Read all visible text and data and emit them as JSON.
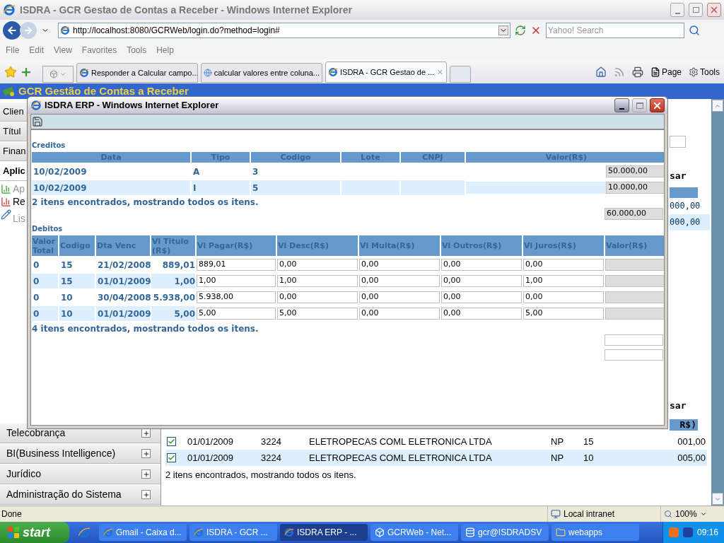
{
  "browser": {
    "title": "ISDRA - GCR Gestao de Contas a Receber - Windows Internet Explorer",
    "address": "http://localhost:8080/GCRWeb/login.do?method=login#",
    "search_placeholder": "Yahoo! Search",
    "menu": [
      "File",
      "Edit",
      "View",
      "Favorites",
      "Tools",
      "Help"
    ],
    "tabs": [
      {
        "label": "Responder a Calcular campo...",
        "selected": false
      },
      {
        "label": "calcular valores entre coluna...",
        "selected": false
      },
      {
        "label": "ISDRA - GCR Gestao de ...",
        "selected": true
      }
    ],
    "command_bar": [
      "Page",
      "Tools"
    ]
  },
  "app": {
    "header": "GCR Gestão de Contas a Receber",
    "sidebar": [
      {
        "kind": "section",
        "label": "Clien",
        "selected": false
      },
      {
        "kind": "section",
        "label": "Títul",
        "selected": false
      },
      {
        "kind": "section",
        "label": "Finan",
        "selected": false
      },
      {
        "kind": "section",
        "label": "Aplic",
        "selected": true
      },
      {
        "kind": "link",
        "label": "Ap"
      },
      {
        "kind": "link",
        "label": "Re"
      },
      {
        "kind": "link",
        "label": "Lis"
      }
    ],
    "sidebar_bottom": [
      {
        "label": "Telecobrança",
        "expanded": false
      },
      {
        "label": "BI(Business Intelligence)",
        "expanded": false
      },
      {
        "label": "Jurídico",
        "expanded": false
      },
      {
        "label": "Administração do Sistema",
        "expanded": false
      }
    ],
    "right_panel": {
      "label_1": "sar",
      "values": [
        "000,00",
        "000,00"
      ],
      "label_2": "sar",
      "header": "R$)"
    },
    "rows": [
      {
        "checked": true,
        "date": "01/01/2009",
        "code": "3224",
        "company": "ELETROPECAS COML ELETRONICA LTDA",
        "type": "NP",
        "number": "15",
        "value": "001,00"
      },
      {
        "checked": true,
        "date": "01/01/2009",
        "code": "3224",
        "company": "ELETROPECAS COML ELETRONICA LTDA",
        "type": "NP",
        "number": "10",
        "value": "005,00"
      }
    ],
    "footer": "2 itens encontrados, mostrando todos os itens."
  },
  "popup": {
    "title": "ISDRA ERP - Windows Internet Explorer",
    "creditos": {
      "label": "Creditos",
      "columns": [
        "Data",
        "Tipo",
        "Codigo",
        "Lote",
        "CNPJ",
        "Valor(R$)"
      ],
      "rows": [
        {
          "data": "10/02/2009",
          "tipo": "A",
          "codigo": "3",
          "valor": "50.000,00"
        },
        {
          "data": "10/02/2009",
          "tipo": "I",
          "codigo": "5",
          "valor": "10.000,00"
        }
      ],
      "footer": "2 itens encontrados, mostrando todos os itens.",
      "total": "60.000,00"
    },
    "debitos": {
      "label": "Debitos",
      "columns": [
        "Valor Total",
        "Codigo",
        "Dta Venc",
        "Vl Titulo (R$)",
        "Vl Pagar(R$)",
        "Vl Desc(R$)",
        "Vl Multa(R$)",
        "Vl Outros(R$)",
        "Vl Juros(R$)",
        "Valor(R$)"
      ],
      "rows": [
        {
          "valor_total": "0",
          "codigo": "15",
          "dta_venc": "21/02/2008",
          "vl_titulo": "889,01",
          "inputs": [
            "889,01",
            "0,00",
            "0,00",
            "0,00",
            "0,00"
          ]
        },
        {
          "valor_total": "0",
          "codigo": "15",
          "dta_venc": "01/01/2009",
          "vl_titulo": "1,00",
          "inputs": [
            "1,00",
            "1,00",
            "0,00",
            "0,00",
            "1,00"
          ]
        },
        {
          "valor_total": "0",
          "codigo": "10",
          "dta_venc": "30/04/2008",
          "vl_titulo": "5.938,00",
          "inputs": [
            "5.938,00",
            "0,00",
            "0,00",
            "0,00",
            "0,00"
          ]
        },
        {
          "valor_total": "0",
          "codigo": "10",
          "dta_venc": "01/01/2009",
          "vl_titulo": "5,00",
          "inputs": [
            "5,00",
            "5,00",
            "0,00",
            "0,00",
            "5,00"
          ]
        }
      ],
      "footer": "4 itens encontrados, mostrando todos os itens."
    }
  },
  "status_bar": {
    "text": "Done",
    "zone": "Local intranet",
    "zoom": "100%"
  },
  "taskbar": {
    "start": "start",
    "tasks": [
      {
        "label": "Gmail - Caixa d...",
        "selected": false
      },
      {
        "label": "ISDRA - GCR ...",
        "selected": false
      },
      {
        "label": "ISDRA ERP - ...",
        "selected": true
      },
      {
        "label": "GCRWeb - Net...",
        "selected": false
      },
      {
        "label": "gcr@ISDRADSV",
        "selected": false
      },
      {
        "label": "webapps",
        "selected": false
      }
    ],
    "clock": "09:16"
  }
}
